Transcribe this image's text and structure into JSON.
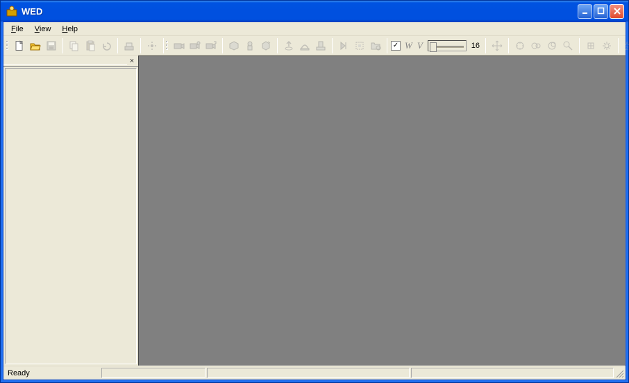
{
  "window": {
    "title": "WED"
  },
  "menu": {
    "file": "File",
    "view": "View",
    "help": "Help"
  },
  "toolbar": {
    "checkbox_checked": "✓",
    "w_label": "W",
    "v_label": "V",
    "slider_value": "16"
  },
  "panel": {
    "close": "×"
  },
  "status": {
    "ready": "Ready"
  }
}
